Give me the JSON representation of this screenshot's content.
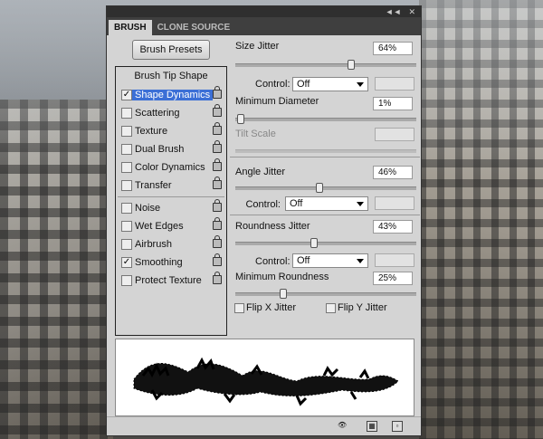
{
  "panel": {
    "tabs": [
      {
        "label": "BRUSH",
        "active": true
      },
      {
        "label": "CLONE SOURCE",
        "active": false
      }
    ],
    "topbar": {
      "collapse_glyph": "◄◄",
      "menu_glyph": "✕"
    },
    "brush_presets_label": "Brush Presets",
    "list": {
      "header": "Brush Tip Shape",
      "items": [
        {
          "label": "Shape Dynamics",
          "checked": true,
          "selected": true
        },
        {
          "label": "Scattering",
          "checked": false
        },
        {
          "label": "Texture",
          "checked": false
        },
        {
          "label": "Dual Brush",
          "checked": false
        },
        {
          "label": "Color Dynamics",
          "checked": false
        },
        {
          "label": "Transfer",
          "checked": false
        },
        {
          "label": "Noise",
          "checked": false
        },
        {
          "label": "Wet Edges",
          "checked": false
        },
        {
          "label": "Airbrush",
          "checked": false
        },
        {
          "label": "Smoothing",
          "checked": true
        },
        {
          "label": "Protect Texture",
          "checked": false
        }
      ]
    },
    "settings": {
      "size_jitter": {
        "label": "Size Jitter",
        "value": "64%",
        "level": 0.64
      },
      "control1": {
        "label": "Control:",
        "value": "Off"
      },
      "min_diameter": {
        "label": "Minimum Diameter",
        "value": "1%",
        "level": 0.01
      },
      "tilt_scale": {
        "label": "Tilt Scale"
      },
      "angle_jitter": {
        "label": "Angle Jitter",
        "value": "46%",
        "level": 0.46
      },
      "control2": {
        "label": "Control:",
        "value": "Off"
      },
      "roundness_jitter": {
        "label": "Roundness Jitter",
        "value": "43%",
        "level": 0.43
      },
      "control3": {
        "label": "Control:",
        "value": "Off"
      },
      "min_roundness": {
        "label": "Minimum Roundness",
        "value": "25%",
        "level": 0.25
      },
      "flip_x": {
        "label": "Flip X Jitter",
        "checked": false
      },
      "flip_y": {
        "label": "Flip Y Jitter",
        "checked": false
      }
    }
  },
  "colors": {
    "selection": "#3b6fd6",
    "panel": "#d4d4d4"
  }
}
